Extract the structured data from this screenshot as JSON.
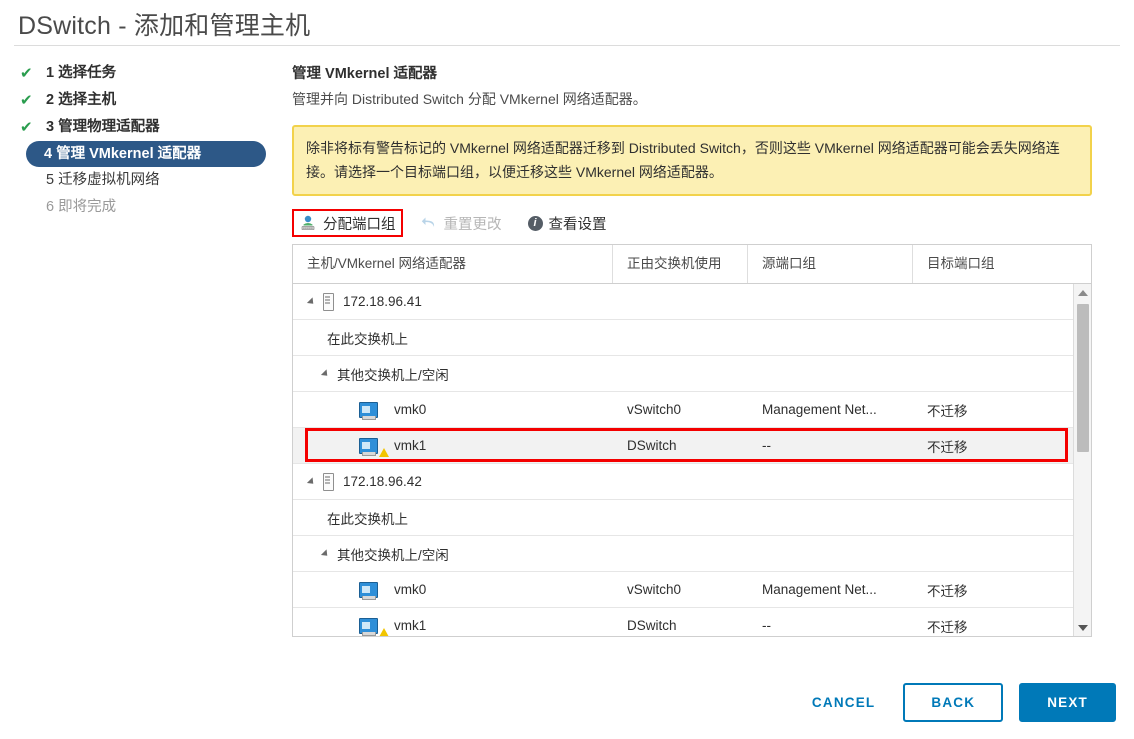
{
  "window": {
    "title": "DSwitch - 添加和管理主机"
  },
  "steps": [
    {
      "number": "1",
      "label": "选择任务",
      "state": "done",
      "check": "✔"
    },
    {
      "number": "2",
      "label": "选择主机",
      "state": "done",
      "check": "✔"
    },
    {
      "number": "3",
      "label": "管理物理适配器",
      "state": "done",
      "check": "✔"
    },
    {
      "number": "4",
      "label": "管理 VMkernel 适配器",
      "state": "active",
      "check": ""
    },
    {
      "number": "5",
      "label": "迁移虚拟机网络",
      "state": "todo",
      "check": ""
    },
    {
      "number": "6",
      "label": "即将完成",
      "state": "muted",
      "check": ""
    }
  ],
  "main": {
    "heading": "管理 VMkernel 适配器",
    "subheading": "管理并向 Distributed Switch 分配 VMkernel 网络适配器。",
    "warning": "除非将标有警告标记的 VMkernel 网络适配器迁移到 Distributed Switch，否则这些 VMkernel 网络适配器可能会丢失网络连接。请选择一个目标端口组，以便迁移这些 VMkernel 网络适配器。"
  },
  "toolbar": {
    "assign_label": "分配端口组",
    "assign_icon": "assign-portgroup-icon",
    "reset_label": "重置更改",
    "reset_icon": "undo-icon",
    "view_label": "查看设置",
    "view_icon": "info-icon",
    "highlight_color": "#f40000"
  },
  "table": {
    "columns": [
      "主机/VMkernel 网络适配器",
      "正由交换机使用",
      "源端口组",
      "目标端口组"
    ],
    "rows": [
      {
        "type": "host",
        "name": "172.18.96.41",
        "switch": "",
        "source": "",
        "target": "",
        "selected": false
      },
      {
        "type": "group",
        "name": "在此交换机上",
        "switch": "",
        "source": "",
        "target": "",
        "selected": false
      },
      {
        "type": "sub",
        "name": "其他交换机上/空闲",
        "switch": "",
        "source": "",
        "target": "",
        "selected": false
      },
      {
        "type": "leaf",
        "name": "vmk0",
        "switch": "vSwitch0",
        "source": "Management Net...",
        "target": "不迁移",
        "warn": false,
        "selected": false
      },
      {
        "type": "leaf",
        "name": "vmk1",
        "switch": "DSwitch",
        "source": "--",
        "target": "不迁移",
        "warn": true,
        "selected": true
      },
      {
        "type": "host",
        "name": "172.18.96.42",
        "switch": "",
        "source": "",
        "target": "",
        "selected": false
      },
      {
        "type": "group",
        "name": "在此交换机上",
        "switch": "",
        "source": "",
        "target": "",
        "selected": false
      },
      {
        "type": "sub",
        "name": "其他交换机上/空闲",
        "switch": "",
        "source": "",
        "target": "",
        "selected": false
      },
      {
        "type": "leaf",
        "name": "vmk0",
        "switch": "vSwitch0",
        "source": "Management Net...",
        "target": "不迁移",
        "warn": false,
        "selected": false
      },
      {
        "type": "leaf",
        "name": "vmk1",
        "switch": "DSwitch",
        "source": "--",
        "target": "不迁移",
        "warn": true,
        "selected": false
      },
      {
        "type": "host",
        "name": "",
        "switch": "",
        "source": "",
        "target": "",
        "selected": false
      }
    ]
  },
  "footer": {
    "cancel_label": "CANCEL",
    "back_label": "BACK",
    "next_label": "NEXT",
    "accent_color": "#0079b8"
  }
}
